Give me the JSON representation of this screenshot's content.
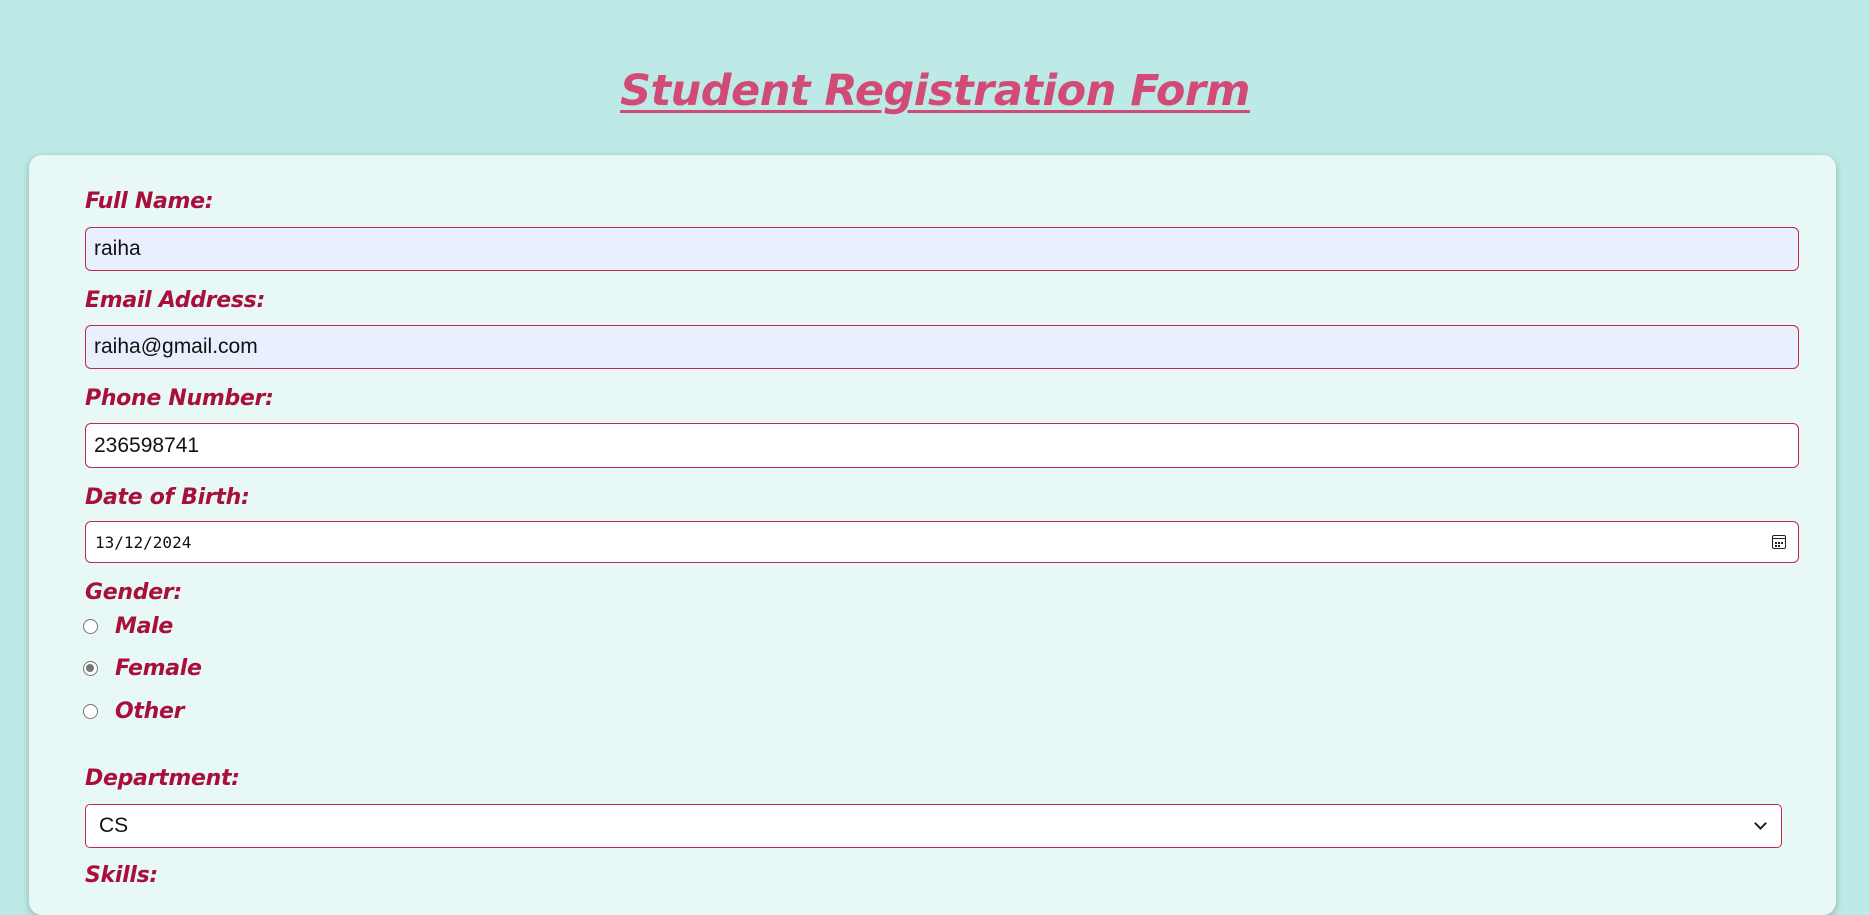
{
  "page": {
    "title": "Student Registration Form"
  },
  "form": {
    "full_name": {
      "label": "Full Name:",
      "value": "raiha"
    },
    "email": {
      "label": "Email Address:",
      "value": "raiha@gmail.com"
    },
    "phone": {
      "label": "Phone Number:",
      "value": "236598741"
    },
    "dob": {
      "label": "Date of Birth:",
      "value": "13/12/2024"
    },
    "gender": {
      "label": "Gender:",
      "options": [
        {
          "label": "Male",
          "checked": false
        },
        {
          "label": "Female",
          "checked": true
        },
        {
          "label": "Other",
          "checked": false
        }
      ]
    },
    "department": {
      "label": "Department:",
      "value": "CS"
    },
    "skills": {
      "label": "Skills:"
    }
  },
  "colors": {
    "background": "#bdeae6",
    "card": "#e8f8f7",
    "title": "#d24a76",
    "label": "#a80f3a",
    "input_border": "#c2284f",
    "autofill": "#e8f0fe"
  }
}
